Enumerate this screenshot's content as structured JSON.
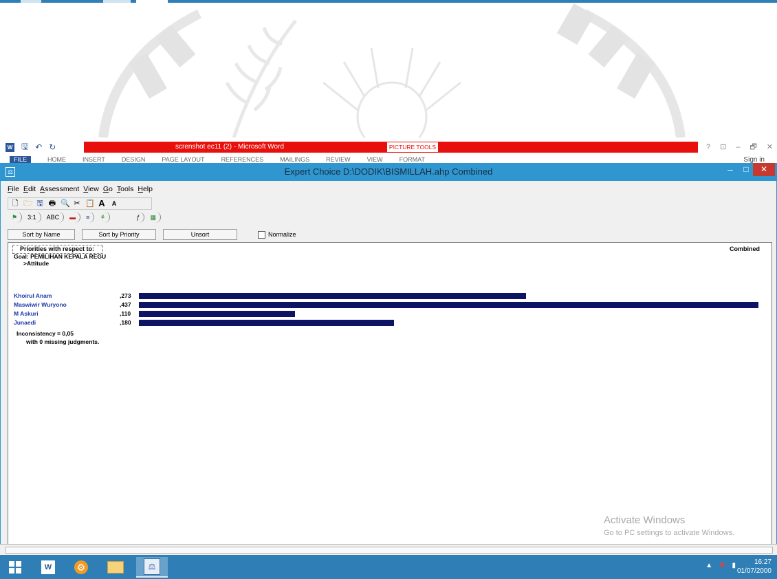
{
  "word": {
    "doc_title": "screnshot ec11 (2) - Microsoft Word",
    "picture_tools": "PICTURE TOOLS",
    "tabs": [
      "FILE",
      "HOME",
      "INSERT",
      "DESIGN",
      "PAGE LAYOUT",
      "REFERENCES",
      "MAILINGS",
      "REVIEW",
      "VIEW",
      "FORMAT"
    ],
    "sign_in": "Sign in",
    "window_controls": [
      "?",
      "⊡",
      "–",
      "🗗",
      "✕"
    ]
  },
  "ec": {
    "title": "Expert Choice    D:\\DODIK\\BISMILLAH.ahp   Combined",
    "menu": [
      {
        "mnemonic": "F",
        "rest": "ile"
      },
      {
        "mnemonic": "E",
        "rest": "dit"
      },
      {
        "mnemonic": "A",
        "rest": "ssessment"
      },
      {
        "mnemonic": "V",
        "rest": "iew"
      },
      {
        "mnemonic": "G",
        "rest": "o"
      },
      {
        "mnemonic": "T",
        "rest": "ools"
      },
      {
        "mnemonic": "H",
        "rest": "elp"
      }
    ],
    "toolbar2_labels": {
      "ratio": "3:1",
      "abc": "ABC"
    },
    "buttons": {
      "sort_by_name": "Sort by Name",
      "sort_by_priority": "Sort by Priority",
      "unsort": "Unsort",
      "normalize": "Normalize"
    },
    "priorities_header": "Priorities with respect to:",
    "combined_label": "Combined",
    "goal": "Goal: PEMILIHAN KEPALA REGU",
    "node": ">Attitude",
    "alternatives": [
      {
        "name": "Khoirul Anam",
        "value_text": ",273",
        "value": 0.273
      },
      {
        "name": "Maswiwir Wuryono",
        "value_text": ",437",
        "value": 0.437
      },
      {
        "name": "M Askuri",
        "value_text": ",110",
        "value": 0.11
      },
      {
        "name": "Junaedi",
        "value_text": ",180",
        "value": 0.18
      }
    ],
    "inconsistency": "Inconsistency = 0,05",
    "missing": "with 0  missing judgments."
  },
  "activate": {
    "line1": "Activate Windows",
    "line2": "Go to PC settings to activate Windows."
  },
  "taskbar": {
    "time": "16:27",
    "date": "01/07/2000"
  }
}
